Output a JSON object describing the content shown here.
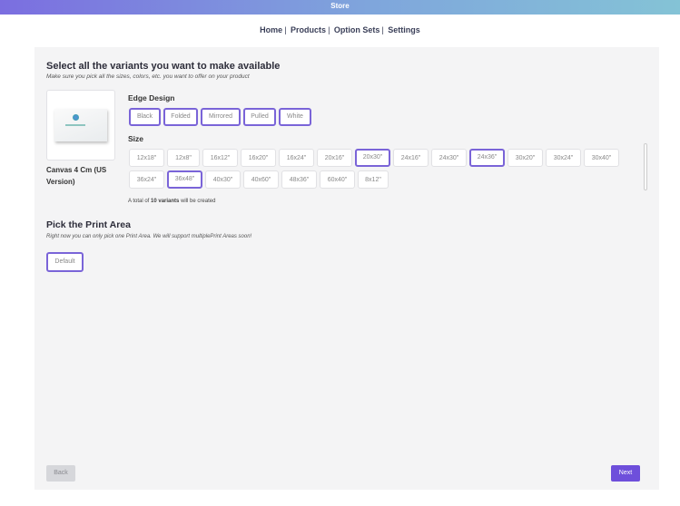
{
  "app": {
    "title": "Store"
  },
  "nav": {
    "items": [
      "Home",
      "Products",
      "Option Sets",
      "Settings"
    ]
  },
  "variants": {
    "heading": "Select all the variants you want to make available",
    "subheading": "Make sure you pick all the sizes, colors, etc. you want to offer on your product",
    "product": {
      "name": "Canvas 4 Cm (US Version)",
      "image_icon": "canvas-thumbnail"
    },
    "edge_design": {
      "label": "Edge Design",
      "options": [
        {
          "label": "Black",
          "selected": true
        },
        {
          "label": "Folded",
          "selected": true
        },
        {
          "label": "Mirrored",
          "selected": true
        },
        {
          "label": "Pulled",
          "selected": true
        },
        {
          "label": "White",
          "selected": true
        }
      ]
    },
    "size": {
      "label": "Size",
      "options": [
        {
          "label": "12x18\"",
          "selected": false
        },
        {
          "label": "12x8\"",
          "selected": false
        },
        {
          "label": "16x12\"",
          "selected": false
        },
        {
          "label": "16x20\"",
          "selected": false
        },
        {
          "label": "16x24\"",
          "selected": false
        },
        {
          "label": "20x16\"",
          "selected": false
        },
        {
          "label": "20x30\"",
          "selected": true
        },
        {
          "label": "24x16\"",
          "selected": false
        },
        {
          "label": "24x30\"",
          "selected": false
        },
        {
          "label": "24x36\"",
          "selected": true
        },
        {
          "label": "30x20\"",
          "selected": false
        },
        {
          "label": "30x24\"",
          "selected": false
        },
        {
          "label": "30x40\"",
          "selected": false
        },
        {
          "label": "36x24\"",
          "selected": false
        },
        {
          "label": "36x48\"",
          "selected": true
        },
        {
          "label": "40x30\"",
          "selected": false
        },
        {
          "label": "40x60\"",
          "selected": false
        },
        {
          "label": "48x36\"",
          "selected": false
        },
        {
          "label": "60x40\"",
          "selected": false
        },
        {
          "label": "8x12\"",
          "selected": false
        }
      ]
    },
    "total_note": {
      "prefix": "A total of",
      "count": "10 variants",
      "suffix": "will be created"
    }
  },
  "print_area": {
    "heading": "Pick the Print Area",
    "subheading": "Right now you can only pick one Print Area. We will support multiplePrint Areas soon!",
    "options": [
      {
        "label": "Default",
        "selected": true
      }
    ]
  },
  "footer": {
    "back_label": "Back",
    "next_label": "Next"
  },
  "colors": {
    "accent": "#6e4fdb",
    "selected_border": "#7a64d8",
    "panel_bg": "#f4f4f5"
  }
}
